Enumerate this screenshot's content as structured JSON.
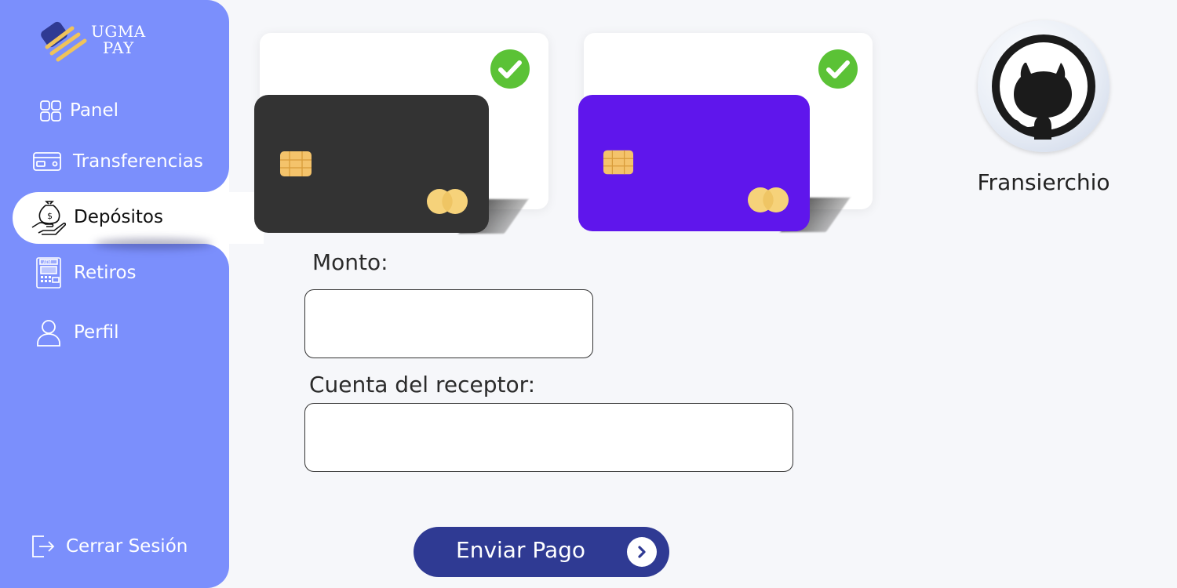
{
  "brand": {
    "line1": "UGMA",
    "line2": "PAY"
  },
  "sidebar": {
    "items": [
      {
        "label": "Panel",
        "icon": "grid-icon",
        "active": false
      },
      {
        "label": "Transferencias",
        "icon": "credit-card-icon",
        "active": false
      },
      {
        "label": "Depósitos",
        "icon": "money-bag-hand-icon",
        "active": true
      },
      {
        "label": "Retiros",
        "icon": "atm-icon",
        "active": false
      },
      {
        "label": "Perfil",
        "icon": "user-icon",
        "active": false
      }
    ],
    "logout_label": "Cerrar Sesión"
  },
  "cards": [
    {
      "color": "#333333",
      "selected": true
    },
    {
      "color": "#5f16ec",
      "selected": true
    }
  ],
  "form": {
    "amount_label": "Monto:",
    "amount_value": "",
    "receiver_label": "Cuenta del receptor:",
    "receiver_value": "",
    "submit_label": "Enviar Pago"
  },
  "profile": {
    "username": "Fransierchio",
    "avatar_icon": "github-octocat-icon"
  },
  "colors": {
    "sidebar": "#7b8ffc",
    "button": "#2f3a93",
    "check": "#5bc236",
    "chip": "#f4c36b"
  }
}
